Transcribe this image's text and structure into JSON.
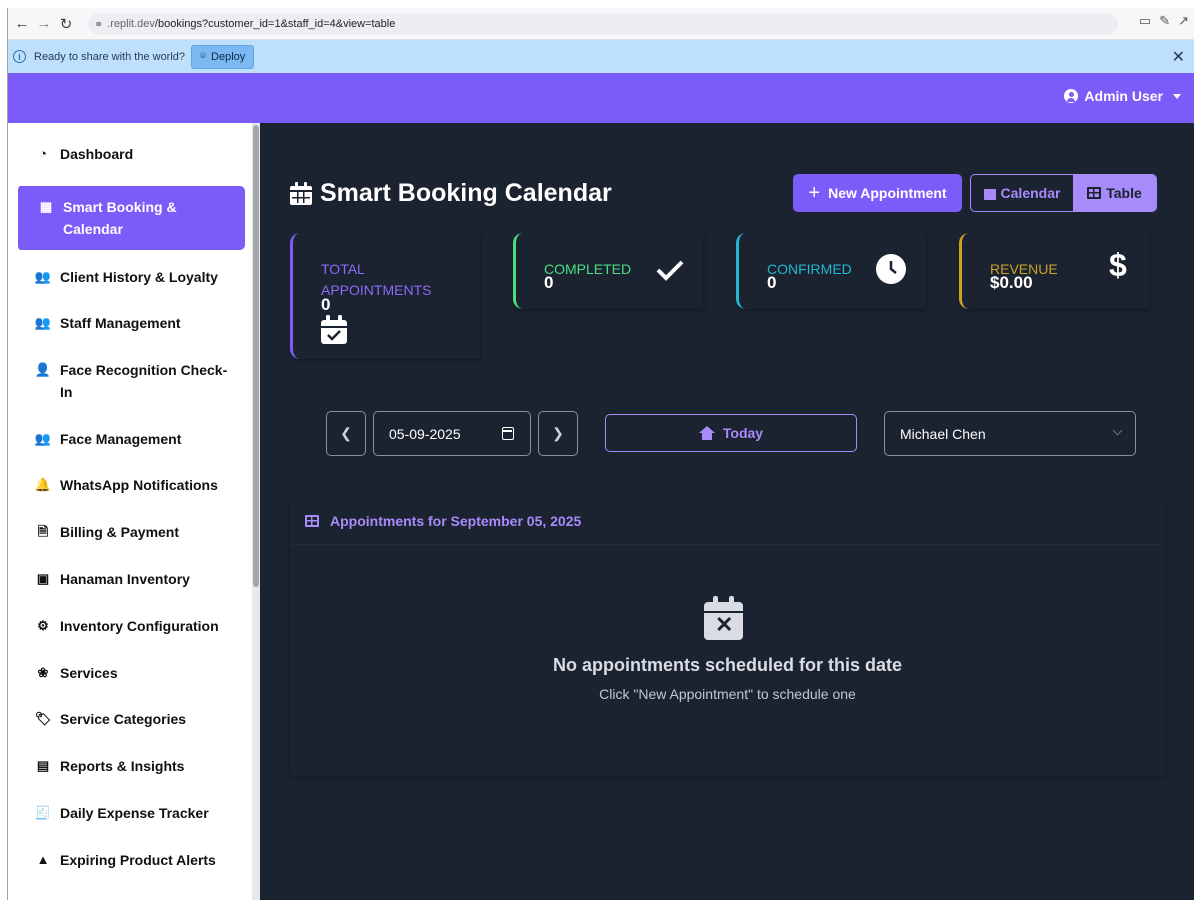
{
  "browser": {
    "url_host": ".replit.dev",
    "url_path": "/bookings?customer_id=1&staff_id=4&view=table"
  },
  "infobar": {
    "message": "Ready to share with the world?",
    "deploy_label": "Deploy"
  },
  "topnav": {
    "user_label": "Admin User"
  },
  "sidebar": {
    "items": [
      {
        "label": "Dashboard",
        "icon": "gauge-icon",
        "glyph": "◔"
      },
      {
        "label": "Smart Booking & Calendar",
        "icon": "calendar-icon",
        "glyph": "▦",
        "active": true
      },
      {
        "label": "Client History & Loyalty",
        "icon": "users-icon",
        "glyph": "👥"
      },
      {
        "label": "Staff Management",
        "icon": "users-cog-icon",
        "glyph": "👥"
      },
      {
        "label": "Face Recognition Check-In",
        "icon": "user-check-icon",
        "glyph": "👤"
      },
      {
        "label": "Face Management",
        "icon": "user-friends-icon",
        "glyph": "👥"
      },
      {
        "label": "WhatsApp Notifications",
        "icon": "bell-icon",
        "glyph": "🔔"
      },
      {
        "label": "Billing & Payment",
        "icon": "invoice-icon",
        "glyph": "🗎"
      },
      {
        "label": "Hanaman Inventory",
        "icon": "boxes-icon",
        "glyph": "▣"
      },
      {
        "label": "Inventory Configuration",
        "icon": "cogs-icon",
        "glyph": "⚙"
      },
      {
        "label": "Services",
        "icon": "spa-icon",
        "glyph": "❀"
      },
      {
        "label": "Service Categories",
        "icon": "tags-icon",
        "glyph": "🏷"
      },
      {
        "label": "Reports & Insights",
        "icon": "chart-icon",
        "glyph": "▤"
      },
      {
        "label": "Daily Expense Tracker",
        "icon": "receipt-icon",
        "glyph": "🧾"
      },
      {
        "label": "Expiring Product Alerts",
        "icon": "warning-icon",
        "glyph": "▲"
      }
    ]
  },
  "page": {
    "title": "Smart Booking Calendar",
    "new_appointment_label": "New Appointment",
    "view_calendar_label": "Calendar",
    "view_table_label": "Table"
  },
  "stats": {
    "total": {
      "label": "TOTAL APPOINTMENTS",
      "value": "0",
      "color": "#7c5cf8"
    },
    "completed": {
      "label": "COMPLETED",
      "value": "0",
      "color": "#4ade80"
    },
    "confirmed": {
      "label": "CONFIRMED",
      "value": "0",
      "color": "#22b8cf"
    },
    "revenue": {
      "label": "REVENUE",
      "value": "$0.00",
      "color": "#c9a227"
    }
  },
  "controls": {
    "date_value": "05-09-2025",
    "today_label": "Today",
    "staff_selected": "Michael Chen"
  },
  "appointments": {
    "heading": "Appointments for September 05, 2025",
    "empty_title": "No appointments scheduled for this date",
    "empty_subtitle": "Click \"New Appointment\" to schedule one"
  },
  "colors": {
    "accent": "#7c5cf8",
    "accent_light": "#a78bfa",
    "background": "#1b2230"
  }
}
